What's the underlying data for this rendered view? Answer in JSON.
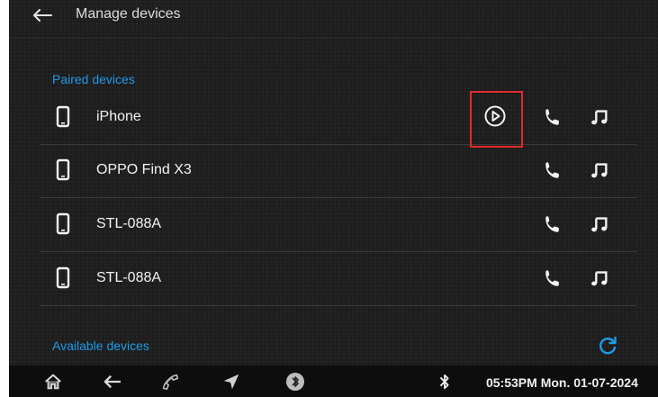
{
  "header": {
    "title": "Manage devices",
    "back_icon": "back-arrow-icon"
  },
  "sections": {
    "paired_label": "Paired devices",
    "available_label": "Available devices"
  },
  "paired_devices": [
    {
      "name": "iPhone",
      "has_play": true
    },
    {
      "name": "OPPO Find X3",
      "has_play": false
    },
    {
      "name": "STL-088A",
      "has_play": false
    },
    {
      "name": "STL-088A",
      "has_play": false
    }
  ],
  "highlight_color": "#e02b2b",
  "accent_color": "#1e9be9",
  "status_bar": {
    "time_date": "05:53PM Mon. 01-07-2024",
    "icons": [
      "home-icon",
      "back-icon",
      "phone-call-icon",
      "navigation-icon",
      "bluetooth-audio-icon",
      "bluetooth-icon"
    ]
  }
}
